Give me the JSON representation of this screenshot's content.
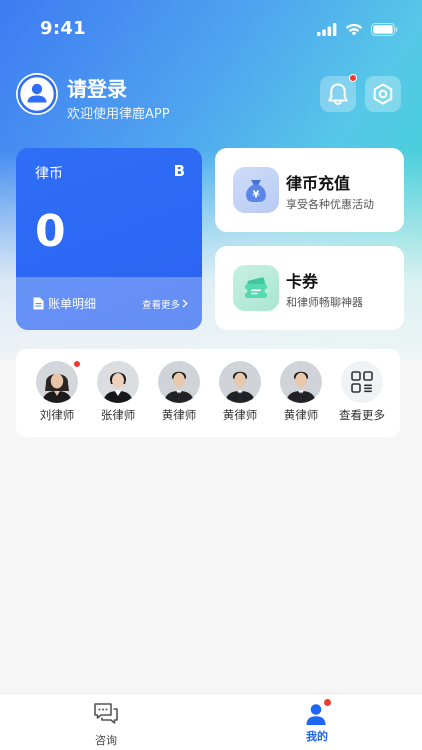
{
  "status_bar": {
    "time": "9:41"
  },
  "profile": {
    "title": "请登录",
    "subtitle": "欢迎使用律鹿APP"
  },
  "coin_card": {
    "label": "律币",
    "symbol": "B",
    "amount": "0",
    "bill_label": "账单明细",
    "see_more": "查看更多"
  },
  "promos": [
    {
      "title": "律币充值",
      "subtitle": "享受各种优惠活动",
      "icon": "money-bag-icon"
    },
    {
      "title": "卡券",
      "subtitle": "和律师畅聊神器",
      "icon": "ticket-icon"
    }
  ],
  "lawyers": [
    {
      "name": "刘律师",
      "has_badge": true
    },
    {
      "name": "张律师"
    },
    {
      "name": "黄律师"
    },
    {
      "name": "黄律师"
    },
    {
      "name": "黄律师"
    }
  ],
  "lawyers_more": "查看更多",
  "tabs": [
    {
      "label": "咨询",
      "active": false
    },
    {
      "label": "我的",
      "active": true
    }
  ],
  "colors": {
    "accent": "#2f6ef7",
    "badge": "#ef3b30",
    "tab_active": "#1f66f2"
  }
}
